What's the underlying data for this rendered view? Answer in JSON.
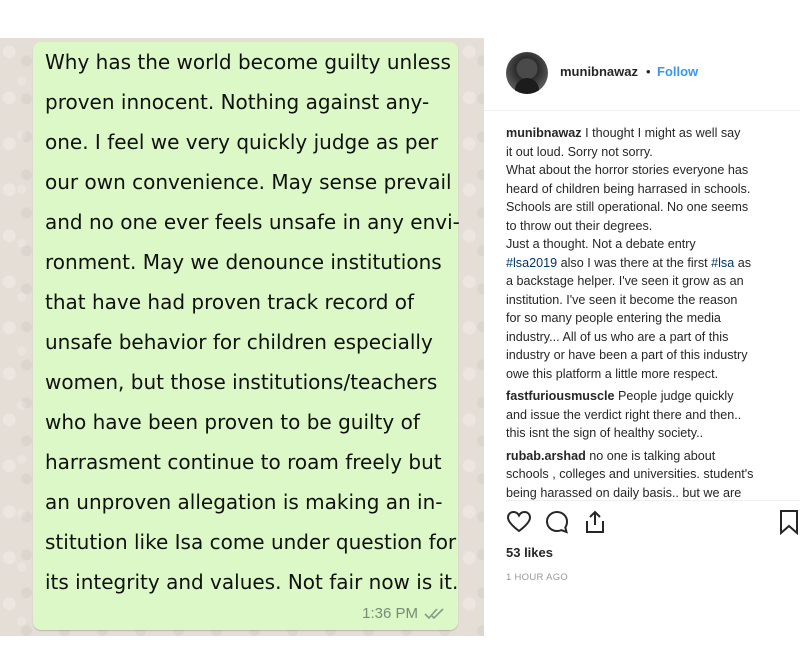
{
  "message": {
    "lines": [
      "Why has the world become guilty unless",
      "proven innocent. Nothing against any-",
      "one. I feel we very quickly judge as per",
      "our own convenience. May sense prevail",
      "and no one ever feels unsafe in any envi-",
      "ronment. May we denounce institutions",
      "that have had proven track record of",
      "unsafe behavior for children especially",
      "women, but those institutions/teachers",
      "who have been proven to be guilty of",
      "harrasment continue to roam freely but",
      "an unproven allegation is making an in-",
      "stitution like Isa come under question for",
      "its integrity and values. Not fair now is it."
    ],
    "time": "1:36 PM"
  },
  "header": {
    "username": "munibnawaz",
    "separator": "•",
    "follow_label": "Follow"
  },
  "caption": {
    "username": "munibnawaz",
    "lines": [
      " I thought I might as well say",
      "it out loud. Sorry not sorry.",
      "What about the horror stories everyone has",
      "heard of children being harrased in schools.",
      "Schools are still operational. No one seems",
      "to throw out their degrees.",
      "Just a thought. Not a debate entry",
      "also I was there at the first",
      "a backstage helper. I've seen it grow as an",
      "institution. I've seen it become the reason",
      "for so many people entering the media",
      "industry... All of us who are a part of this",
      "industry or have been a part of this industry",
      "owe this platform a little more respect."
    ],
    "hashtag1": "#lsa2019",
    "hashtag2": "#lsa",
    "hashtag2_suffix": " as"
  },
  "comments": [
    {
      "username": "fastfuriousmuscle",
      "first_line": " People judge quickly",
      "lines": [
        "and issue the verdict right there and then..",
        "this isnt the sign of healthy society.."
      ]
    },
    {
      "username": "rubab.arshad",
      "first_line": " no one is talking about",
      "lines": [
        "schools , colleges and universities. student's",
        "being harassed on daily basis.. but we are"
      ]
    }
  ],
  "likes": "53 likes",
  "time_ago": "1 HOUR AGO",
  "icons": [
    "heart-icon",
    "comment-icon",
    "share-icon",
    "bookmark-icon",
    "double-check-icon"
  ],
  "colors": {
    "bubble": "#dcf8c6",
    "follow": "#3897f0",
    "hashtag": "#003569"
  }
}
